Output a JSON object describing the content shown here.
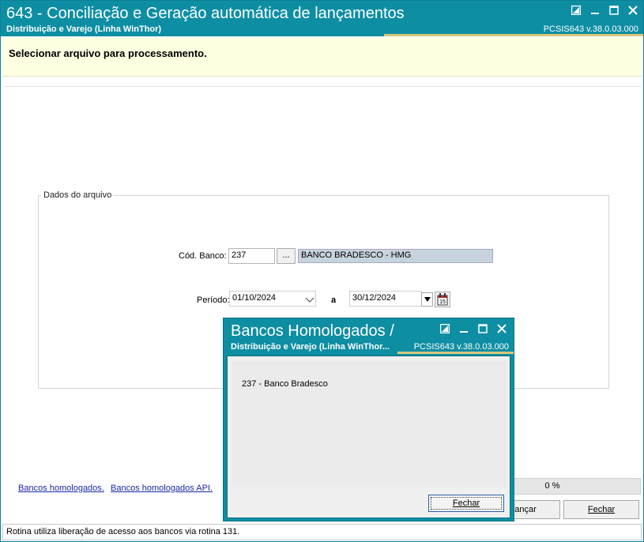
{
  "window": {
    "title": "643 - Conciliação e Geração automática de lançamentos",
    "subtitle": "Distribuição e Varejo (Linha WinThor)",
    "version": "PCSIS643  v.38.0.03.000"
  },
  "banner": {
    "text": "Selecionar arquivo para processamento."
  },
  "group": {
    "title": "Dados do arquivo",
    "bank_label": "Cód. Banco:",
    "bank_code": "237",
    "lookup_label": "...",
    "bank_name": "BANCO BRADESCO - HMG",
    "period_label": "Período:",
    "date_from": "01/10/2024",
    "to_label": "a",
    "date_to": "30/12/2024"
  },
  "links": {
    "banks": "Bancos homologados.",
    "banks_api": "Bancos homologados API."
  },
  "progress": {
    "text": "0 %",
    "value": 0
  },
  "buttons": {
    "cancel": "ançar",
    "close": "Fechar"
  },
  "status": {
    "text": "Rotina utiliza liberação de acesso aos bancos via rotina 131."
  },
  "dialog": {
    "title": "Bancos Homologados /",
    "subtitle": "Distribuição e Varejo (Linha WinThor...",
    "version": "PCSIS643  v.38.0.03.000",
    "items": [
      "237 - Banco Bradesco"
    ],
    "close_label": "Fechar"
  },
  "colors": {
    "titlebar": "#0e8ea3",
    "accent": "#d9c77a",
    "banner": "#ffffe1",
    "link": "#1a27a8"
  },
  "icons": [
    "restore-icon",
    "minimize-icon",
    "maximize-icon",
    "close-icon",
    "chevron-down-icon",
    "calendar-icon"
  ]
}
